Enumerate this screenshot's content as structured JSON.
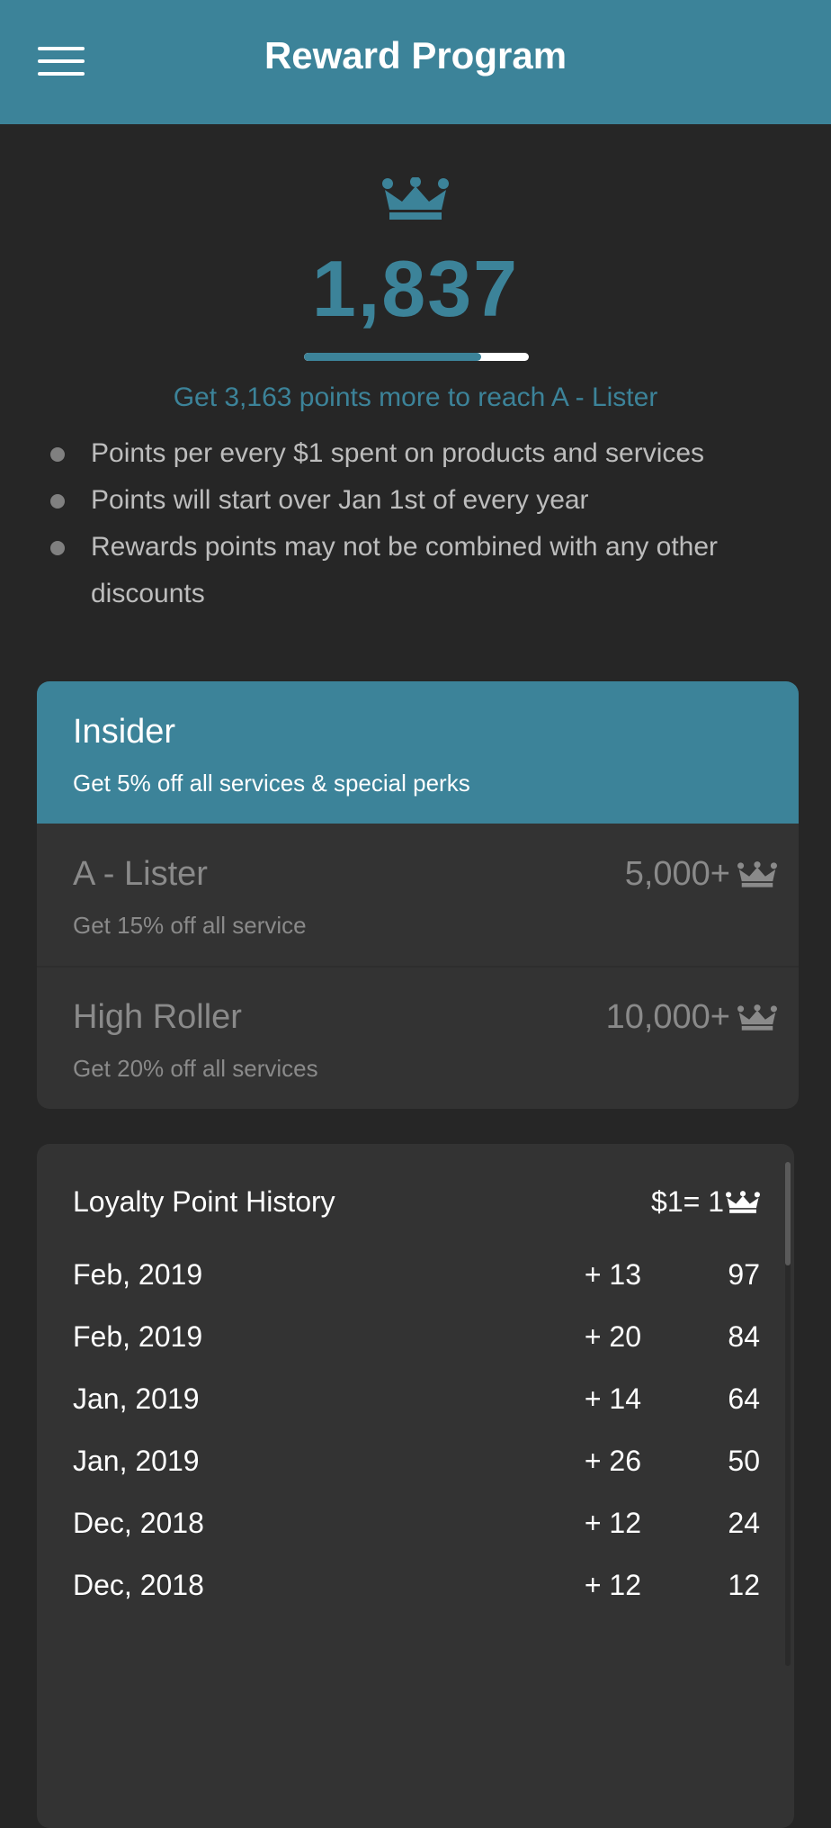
{
  "header": {
    "title": "Reward Program",
    "menu_icon": "hamburger-menu-icon"
  },
  "summary": {
    "crown_icon": "crown-icon",
    "points": "1,837",
    "progress_fraction": 0.787,
    "caption": "Get 3,163 points more to reach A - Lister"
  },
  "rules": [
    "Points per every $1 spent on products and services",
    "Points will start over Jan 1st of every year",
    "Rewards points may not be combined with any other discounts"
  ],
  "tiers": [
    {
      "name": "Insider",
      "description": "Get 5% off all services & special perks",
      "threshold": "",
      "active": true
    },
    {
      "name": "A - Lister",
      "description": "Get 15% off all service",
      "threshold": "5,000+",
      "active": false
    },
    {
      "name": "High Roller",
      "description": "Get 20% off all services",
      "threshold": "10,000+",
      "active": false
    }
  ],
  "history": {
    "title": "Loyalty Point History",
    "rate": "$1= 1",
    "rows": [
      {
        "date": "Feb, 2019",
        "change": "+ 13",
        "total": "97"
      },
      {
        "date": "Feb, 2019",
        "change": "+ 20",
        "total": "84"
      },
      {
        "date": "Jan, 2019",
        "change": "+ 14",
        "total": "64"
      },
      {
        "date": "Jan, 2019",
        "change": "+ 26",
        "total": "50"
      },
      {
        "date": "Dec, 2018",
        "change": "+ 12",
        "total": "24"
      },
      {
        "date": "Dec, 2018",
        "change": "+ 12",
        "total": "12"
      }
    ]
  },
  "colors": {
    "accent": "#3c8399",
    "background": "#262626",
    "card": "#333333",
    "muted_text": "#8a8a8a"
  }
}
